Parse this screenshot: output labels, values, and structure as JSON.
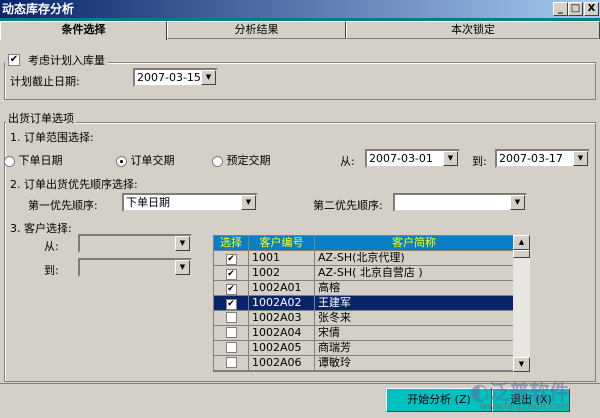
{
  "window": {
    "title": "动态库存分析",
    "min": "_",
    "max": "□",
    "close": "X"
  },
  "tabs": [
    {
      "label": "条件选择"
    },
    {
      "label": "分析结果"
    },
    {
      "label": "本次锁定"
    }
  ],
  "plan": {
    "checkbox_label": "考虑计划入库量",
    "checked": true,
    "date_label": "计划截止日期:",
    "date_value": "2007-03-15"
  },
  "order": {
    "group_label": "出货订单选项",
    "range_label": "1. 订单范围选择:",
    "radios": [
      {
        "label": "下单日期",
        "selected": false
      },
      {
        "label": "订单交期",
        "selected": true
      },
      {
        "label": "预定交期",
        "selected": false
      }
    ],
    "from_label": "从:",
    "from_value": "2007-03-01",
    "to_label": "到:",
    "to_value": "2007-03-17",
    "priority_label": "2. 订单出货优先顺序选择:",
    "first_label": "第一优先顺序:",
    "first_value": "下单日期",
    "second_label": "第二优先顺序:",
    "second_value": "",
    "customer_label": "3. 客户选择:",
    "cust_from_label": "从:",
    "cust_to_label": "到:"
  },
  "grid": {
    "headers": [
      "选择",
      "客户编号",
      "客户简称"
    ],
    "rows": [
      {
        "checked": true,
        "code": "1001",
        "name": "AZ-SH(北京代理)"
      },
      {
        "checked": true,
        "code": "1002",
        "name": "AZ-SH( 北京自营店 )"
      },
      {
        "checked": true,
        "code": "1002A01",
        "name": "高榕"
      },
      {
        "checked": true,
        "code": "1002A02",
        "name": "王建军",
        "selected": true
      },
      {
        "checked": false,
        "code": "1002A03",
        "name": "张冬来"
      },
      {
        "checked": false,
        "code": "1002A04",
        "name": "宋倩"
      },
      {
        "checked": false,
        "code": "1002A05",
        "name": "商瑞芳"
      },
      {
        "checked": false,
        "code": "1002A06",
        "name": "谭敏玲"
      }
    ]
  },
  "buttons": {
    "start": "开始分析 (Z)",
    "exit": "退出 (X)"
  },
  "watermark": {
    "brand": "泛普软件",
    "url": "www.fanpusoft.com"
  }
}
